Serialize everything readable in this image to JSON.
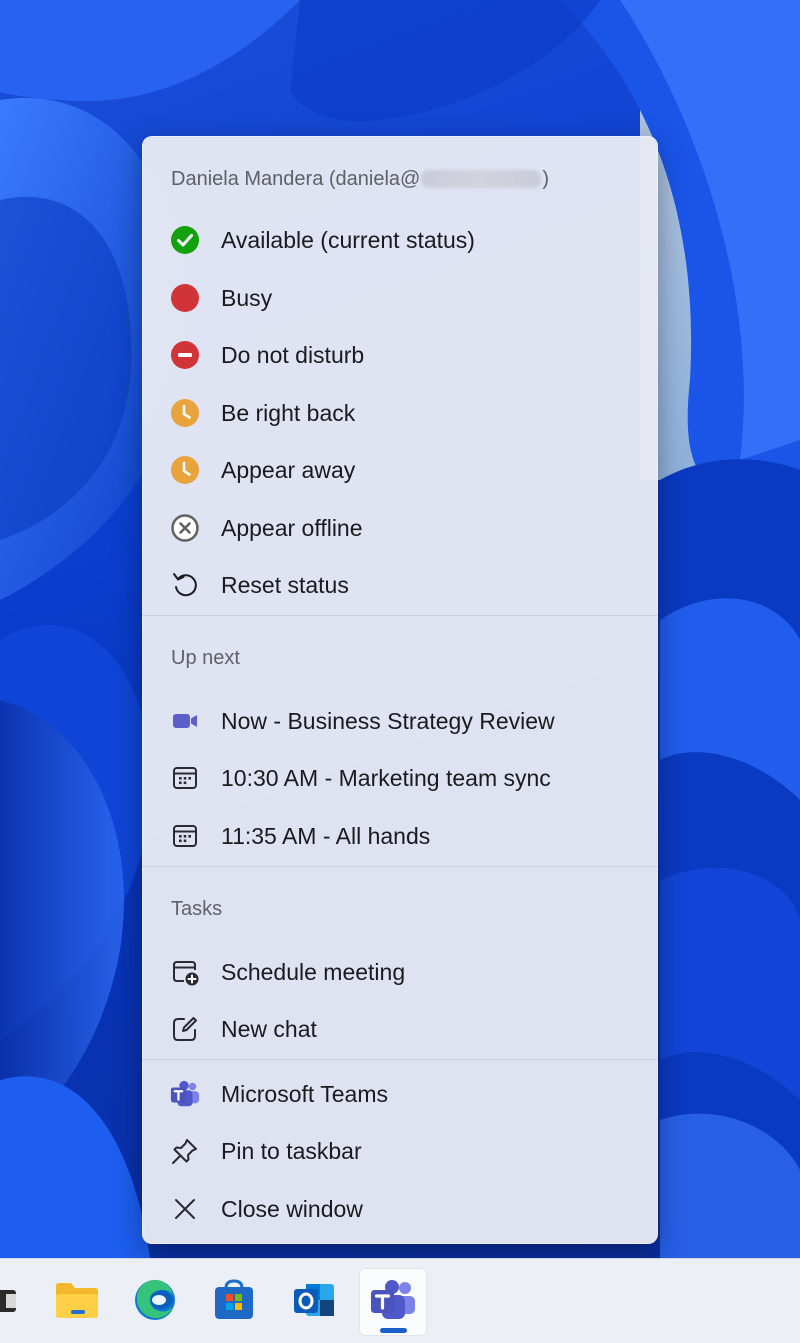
{
  "menu": {
    "account": {
      "name_prefix": "Daniela Mandera (daniela@",
      "name_suffix": ")"
    },
    "status_items": [
      {
        "label": "Available (current status)",
        "icon": "available-check-icon",
        "color": "#13a10e"
      },
      {
        "label": "Busy",
        "icon": "busy-dot-icon",
        "color": "#d13438"
      },
      {
        "label": "Do not disturb",
        "icon": "do-not-disturb-icon",
        "color": "#d13438"
      },
      {
        "label": "Be right back",
        "icon": "clock-icon",
        "color": "#e8a33d"
      },
      {
        "label": "Appear away",
        "icon": "clock-icon",
        "color": "#e8a33d"
      },
      {
        "label": "Appear offline",
        "icon": "offline-x-icon",
        "color": "#616161"
      },
      {
        "label": "Reset status",
        "icon": "reset-arrow-icon",
        "color": "#1b1b1f"
      }
    ],
    "up_next": {
      "heading": "Up next",
      "items": [
        {
          "label": "Now - Business Strategy Review",
          "icon": "video-camera-icon",
          "color": "#5b5fc7"
        },
        {
          "label": "10:30 AM - Marketing team sync",
          "icon": "calendar-icon"
        },
        {
          "label": "11:35 AM - All hands",
          "icon": "calendar-icon"
        }
      ]
    },
    "tasks": {
      "heading": "Tasks",
      "items": [
        {
          "label": "Schedule meeting",
          "icon": "calendar-add-icon"
        },
        {
          "label": "New chat",
          "icon": "compose-icon"
        }
      ]
    },
    "app_items": [
      {
        "label": "Microsoft Teams",
        "icon": "teams-icon"
      },
      {
        "label": "Pin to taskbar",
        "icon": "pin-icon"
      },
      {
        "label": "Close window",
        "icon": "close-icon"
      }
    ]
  },
  "taskbar": {
    "apps": [
      {
        "name": "task-view",
        "icon": "task-view-icon"
      },
      {
        "name": "file-explorer",
        "icon": "folder-icon"
      },
      {
        "name": "edge",
        "icon": "edge-icon"
      },
      {
        "name": "store",
        "icon": "store-icon"
      },
      {
        "name": "outlook",
        "icon": "outlook-icon"
      },
      {
        "name": "teams",
        "icon": "teams-icon",
        "active": true
      }
    ]
  }
}
